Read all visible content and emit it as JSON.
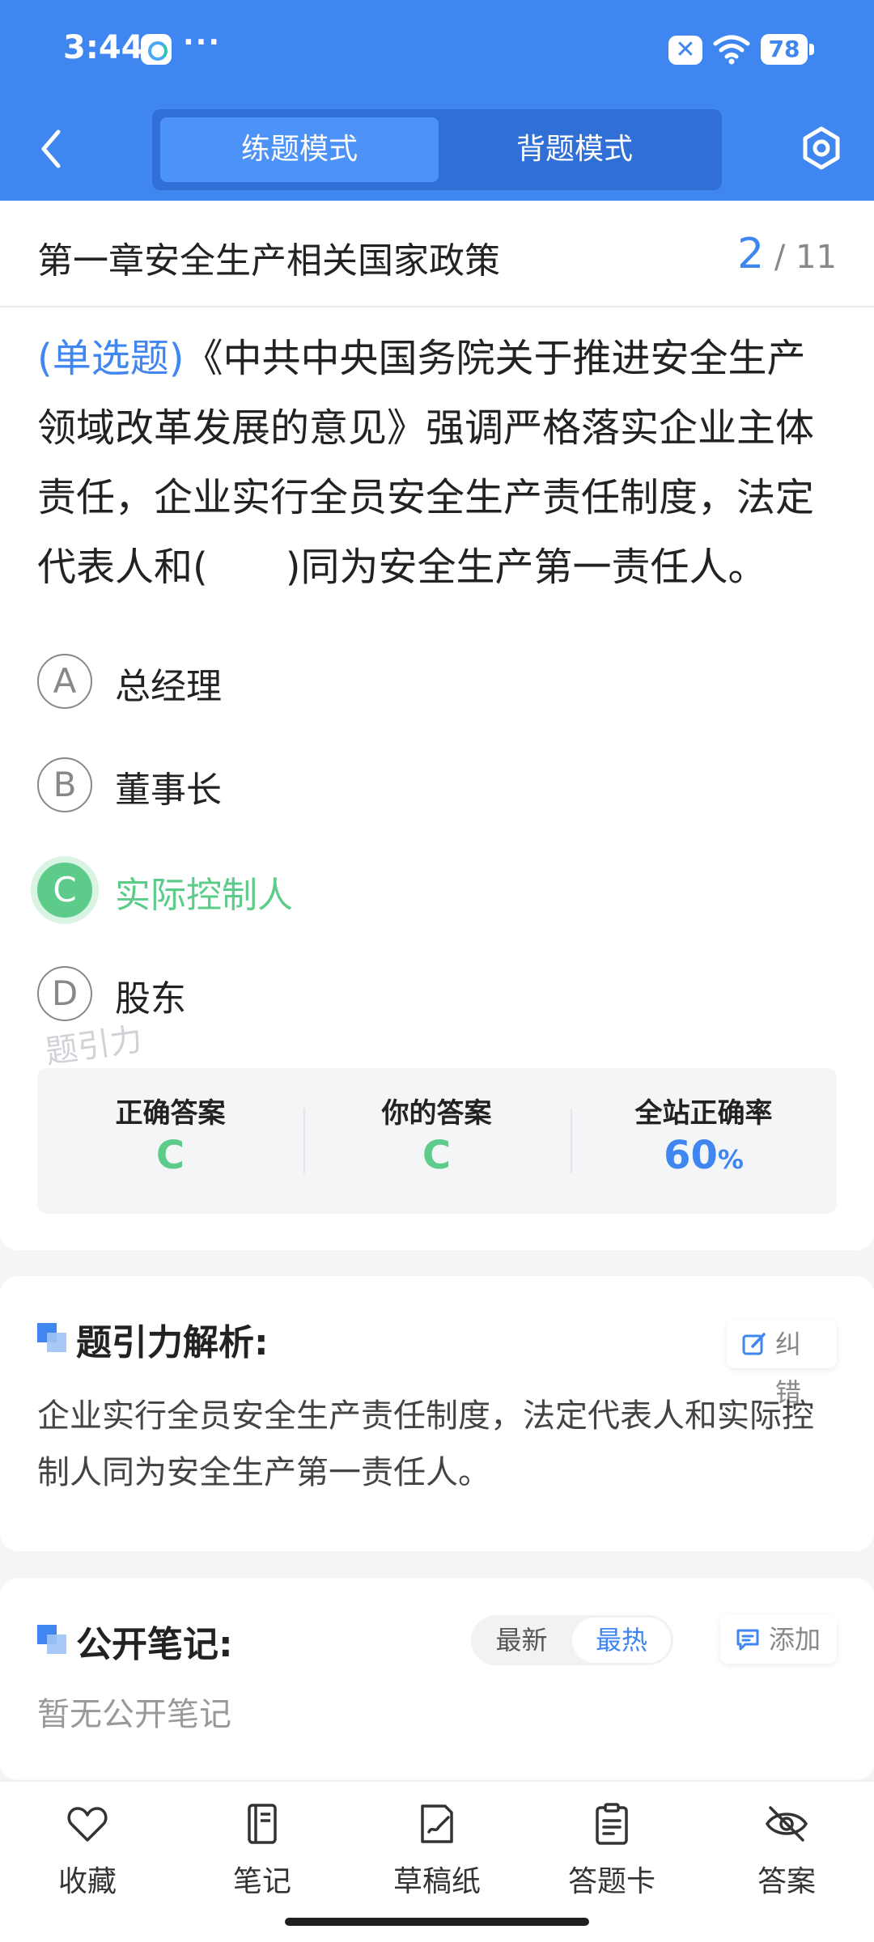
{
  "status_bar": {
    "time": "3:44",
    "dots": "···",
    "x_badge": "✕",
    "battery": "78"
  },
  "header": {
    "tabs": [
      {
        "label": "练题模式",
        "active": true
      },
      {
        "label": "背题模式",
        "active": false
      }
    ],
    "accent_color": "#3f86f0"
  },
  "chapter": {
    "title": "第一章安全生产相关国家政策",
    "current": "2",
    "total": "/ 11"
  },
  "question": {
    "type_label": "(单选题)",
    "text": "《中共中央国务院关于推进安全生产领域改革发展的意见》强调严格落实企业主体责任，企业实行全员安全生产责任制度，法定代表人和(　　)同为安全生产第一责任人。"
  },
  "options": [
    {
      "letter": "A",
      "text": "总经理",
      "correct": false
    },
    {
      "letter": "B",
      "text": "董事长",
      "correct": false
    },
    {
      "letter": "C",
      "text": "实际控制人",
      "correct": true
    },
    {
      "letter": "D",
      "text": "股东",
      "correct": false
    }
  ],
  "watermark": "题引力",
  "answer_summary": {
    "correct_label": "正确答案",
    "correct_value": "C",
    "yours_label": "你的答案",
    "yours_value": "C",
    "rate_label": "全站正确率",
    "rate_value": "60",
    "rate_unit": "%",
    "correct_color": "#5dcc8a"
  },
  "analysis": {
    "title": "题引力解析:",
    "report_button": "纠错",
    "text": "企业实行全员安全生产责任制度，法定代表人和实际控制人同为安全生产第一责任人。"
  },
  "notes": {
    "title": "公开笔记:",
    "sort_options": [
      "最新",
      "最热"
    ],
    "add_button": "添加",
    "empty_text": "暂无公开笔记"
  },
  "bottom_tabs": [
    {
      "label": "收藏",
      "icon": "heart-icon"
    },
    {
      "label": "笔记",
      "icon": "notebook-icon"
    },
    {
      "label": "草稿纸",
      "icon": "draft-paper-icon"
    },
    {
      "label": "答题卡",
      "icon": "answer-card-icon"
    },
    {
      "label": "答案",
      "icon": "eye-off-icon"
    }
  ]
}
